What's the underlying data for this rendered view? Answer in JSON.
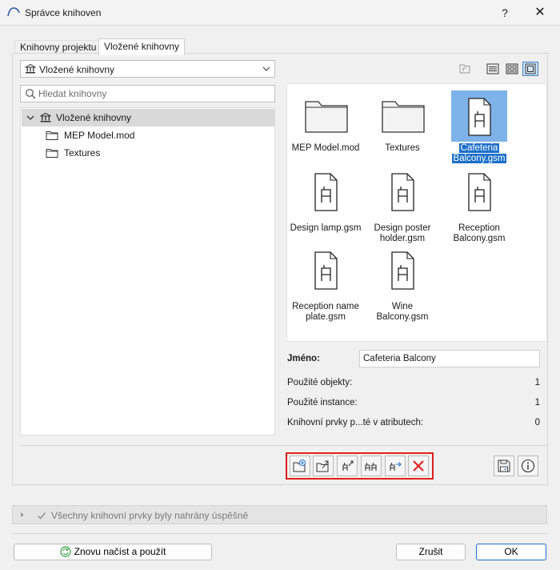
{
  "window": {
    "title": "Správce knihoven",
    "help": "?",
    "close": "✕"
  },
  "tabs": [
    {
      "label": "Knihovny projektu"
    },
    {
      "label": "Vložené knihovny"
    }
  ],
  "source_select": {
    "value": "Vložené knihovny"
  },
  "search": {
    "placeholder": "Hledat knihovny"
  },
  "tree": [
    {
      "label": "Vložené knihovny",
      "type": "library",
      "expanded": true
    },
    {
      "label": "MEP Model.mod",
      "type": "folder"
    },
    {
      "label": "Textures",
      "type": "folder"
    }
  ],
  "view_modes": [
    "list-view",
    "small-icons-view",
    "large-icons-view"
  ],
  "items": [
    {
      "name": "MEP Model.mod",
      "type": "folder"
    },
    {
      "name": "Textures",
      "type": "folder"
    },
    {
      "name": "Cafeteria Balcony.gsm",
      "line1": "Cafeteria",
      "line2": "Balcony.gsm",
      "type": "object",
      "selected": true
    },
    {
      "name": "Design lamp.gsm",
      "type": "object"
    },
    {
      "name": "Design poster holder.gsm",
      "line1": "Design poster",
      "line2": "holder.gsm",
      "type": "object"
    },
    {
      "name": "Reception Balcony.gsm",
      "line1": "Reception",
      "line2": "Balcony.gsm",
      "type": "object"
    },
    {
      "name": "Reception name plate.gsm",
      "line1": "Reception name",
      "line2": "plate.gsm",
      "type": "object"
    },
    {
      "name": "Wine Balcony.gsm",
      "line1": "Wine",
      "line2": "Balcony.gsm",
      "type": "object"
    }
  ],
  "props": {
    "name_label": "Jméno:",
    "name_value": "Cafeteria Balcony",
    "used_objects_label": "Použité objekty:",
    "used_objects_value": "1",
    "used_instances_label": "Použité instance:",
    "used_instances_value": "1",
    "attr_label": "Knihovní prvky p...té v atributech:",
    "attr_value": "0"
  },
  "status": {
    "text": "Všechny knihovní prvky byly nahrány úspěšně"
  },
  "buttons": {
    "reload": "Znovu načíst a použít",
    "cancel": "Zrušit",
    "ok": "OK"
  },
  "colors": {
    "accent": "#1c6fc9",
    "highlight_box": "#e0201c",
    "selection_icon_bg": "#7db3e8"
  }
}
